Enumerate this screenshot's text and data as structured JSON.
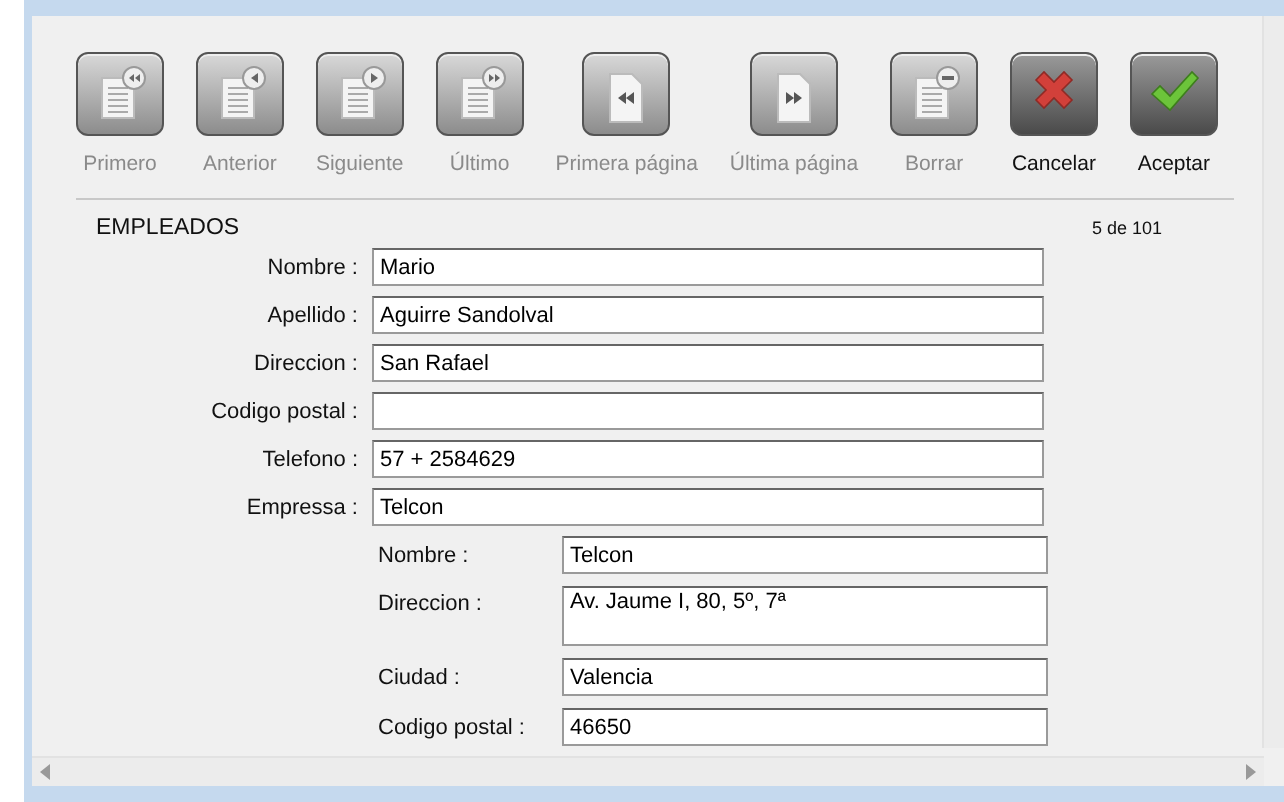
{
  "toolbar": [
    {
      "kind": "first",
      "label": "Primero",
      "disabled": true
    },
    {
      "kind": "previous",
      "label": "Anterior",
      "disabled": true
    },
    {
      "kind": "next",
      "label": "Siguiente",
      "disabled": true
    },
    {
      "kind": "last",
      "label": "Último",
      "disabled": true
    },
    {
      "kind": "first-page",
      "label": "Primera página",
      "disabled": true
    },
    {
      "kind": "last-page",
      "label": "Última página",
      "disabled": true
    },
    {
      "kind": "delete",
      "label": "Borrar",
      "disabled": true
    },
    {
      "kind": "cancel",
      "label": "Cancelar",
      "disabled": false
    },
    {
      "kind": "accept",
      "label": "Aceptar",
      "disabled": false
    }
  ],
  "section": {
    "title": "EMPLEADOS",
    "record_count": "5 de 101"
  },
  "fields": [
    {
      "label": "Nombre :",
      "value": "Mario"
    },
    {
      "label": "Apellido :",
      "value": "Aguirre Sandolval"
    },
    {
      "label": "Direccion :",
      "value": "San Rafael"
    },
    {
      "label": "Codigo postal :"
    },
    {
      "label": "Telefono :",
      "value": "57 + 2584629"
    },
    {
      "label": "Empressa :",
      "value": "Telcon"
    }
  ],
  "company_fields": [
    {
      "label": "Nombre :",
      "value": "Telcon",
      "multiline": false
    },
    {
      "label": "Direccion :",
      "value": "Av. Jaume I, 80, 5º, 7ª",
      "multiline": true
    },
    {
      "label": "Ciudad :",
      "value": "Valencia",
      "multiline": false
    },
    {
      "label": "Codigo postal :",
      "value": "46650",
      "multiline": false
    }
  ]
}
